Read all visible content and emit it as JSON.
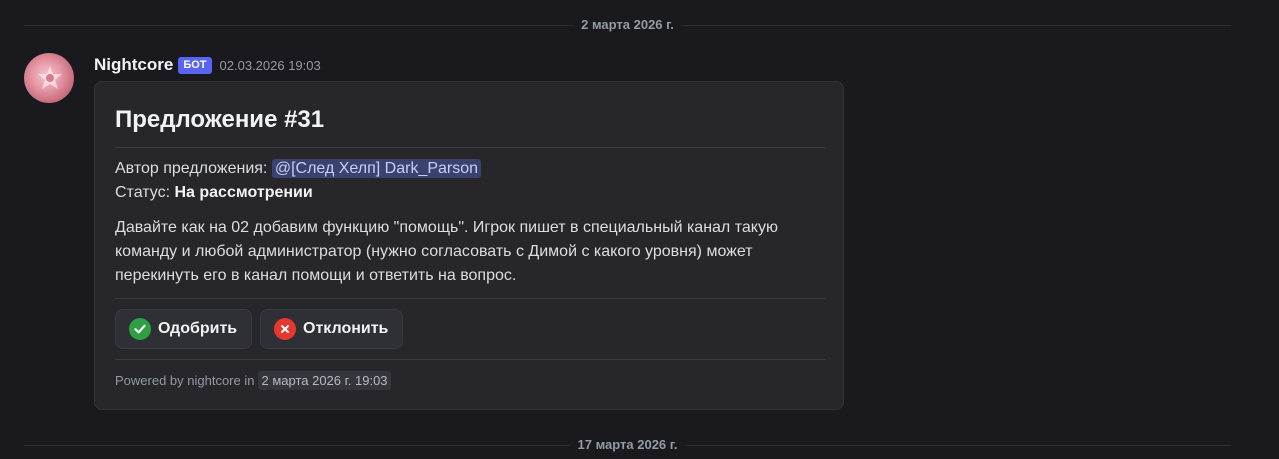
{
  "dividers": [
    {
      "label": "2 марта 2026 г."
    },
    {
      "label": "17 марта 2026 г."
    }
  ],
  "message": {
    "username": "Nightcore",
    "bot_tag": "БОТ",
    "timestamp": "02.03.2026 19:03",
    "avatar_icon": "star-avatar-icon"
  },
  "embed": {
    "title": "Предложение #31",
    "author_label": "Автор предложения:",
    "author_mention": "@[След Хелп] Dark_Parson",
    "status_label": "Статус:",
    "status_value": "На рассмотрении",
    "description": "Давайте как на 02 добавим функцию \"помощь\". Игрок пишет в специальный канал такую команду и любой администратор (нужно согласовать с Димой с какого уровня) может перекинуть его в канал помощи и ответить на вопрос.",
    "buttons": [
      {
        "label": "Одобрить",
        "icon": "check-icon",
        "color": "#2ea043"
      },
      {
        "label": "Отклонить",
        "icon": "x-icon",
        "color": "#e5382f"
      }
    ],
    "footer_text": "Powered by nightcore in",
    "footer_timestamp": "2 марта 2026 г. 19:03"
  }
}
